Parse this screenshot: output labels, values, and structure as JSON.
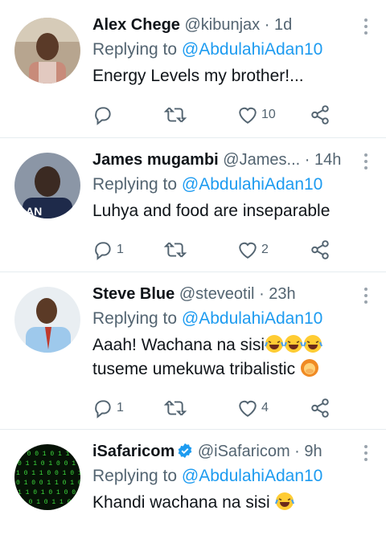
{
  "tweets": [
    {
      "name": "Alex Chege",
      "handle": "@kibunjax",
      "time": "1d",
      "replying_prefix": "Replying to",
      "replying_to": "@AbdulahiAdan10",
      "text": "Energy Levels my brother!...",
      "reply_count": "",
      "like_count": "10"
    },
    {
      "name": "James mugambi",
      "handle": "@James...",
      "time": "14h",
      "replying_prefix": "Replying to",
      "replying_to": "@AbdulahiAdan10",
      "text": "Luhya and food are inseparable",
      "reply_count": "1",
      "like_count": "2"
    },
    {
      "name": "Steve Blue",
      "handle": "@steveotil",
      "time": "23h",
      "replying_prefix": "Replying to",
      "replying_to": "@AbdulahiAdan10",
      "text_line1": "Aaah! Wachana na sisi",
      "text_line2": "tuseme umekuwa tribalistic",
      "reply_count": "1",
      "like_count": "4"
    },
    {
      "name": "iSafaricom",
      "handle": "@iSafaricom",
      "time": "9h",
      "replying_prefix": "Replying to",
      "replying_to": "@AbdulahiAdan10",
      "text": "Khandi wachana na sisi"
    }
  ],
  "separator": "·",
  "colors": {
    "link": "#1d9bf0",
    "secondary": "#536471",
    "verified": "#1d9bf0"
  },
  "icons": [
    "reply-icon",
    "retweet-icon",
    "like-icon",
    "share-icon",
    "more-icon",
    "verified-badge-icon",
    "joy-emoji-icon",
    "facepalm-emoji-icon"
  ]
}
